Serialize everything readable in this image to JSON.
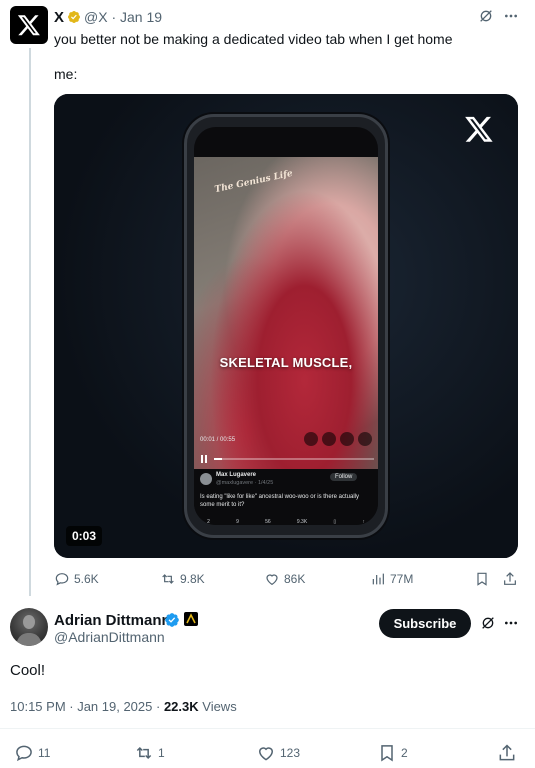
{
  "quoted": {
    "name": "X",
    "handle": "@X · Jan 19",
    "text_line1": "you better not be making a dedicated video tab when I get home",
    "text_line2": "me:",
    "video": {
      "duration_badge": "0:03",
      "screen_logo": "The Genius Life",
      "caption": "SKELETAL MUSCLE,",
      "time": "00:01 / 00:55",
      "inner_author": "Max Lugavere",
      "inner_handle": "@maxlugavere · 1/4/25",
      "inner_follow": "Follow",
      "inner_text": "Is eating \"like for like\" ancestral woo-woo or is there actually some merit to it?",
      "inner_stats": [
        "2",
        "9",
        "56",
        "9.3K",
        "",
        ""
      ]
    },
    "actions": {
      "replies": "5.6K",
      "reposts": "9.8K",
      "likes": "86K",
      "views": "77M"
    },
    "icons": {
      "verified": "gold-verified-icon",
      "grok": "grok-icon",
      "more": "more-icon"
    },
    "colors": {
      "gold_badge": "#e2b719"
    }
  },
  "main": {
    "name": "Adrian Dittmann",
    "handle": "@AdrianDittmann",
    "subscribe_label": "Subscribe",
    "text": "Cool!",
    "timestamp": "10:15 PM · Jan 19, 2025 · ",
    "views_count": "22.3K",
    "views_label": " Views",
    "actions": {
      "replies": "11",
      "reposts": "1",
      "likes": "123",
      "bookmarks": "2"
    },
    "colors": {
      "verified_blue": "#1d9bf0"
    }
  }
}
